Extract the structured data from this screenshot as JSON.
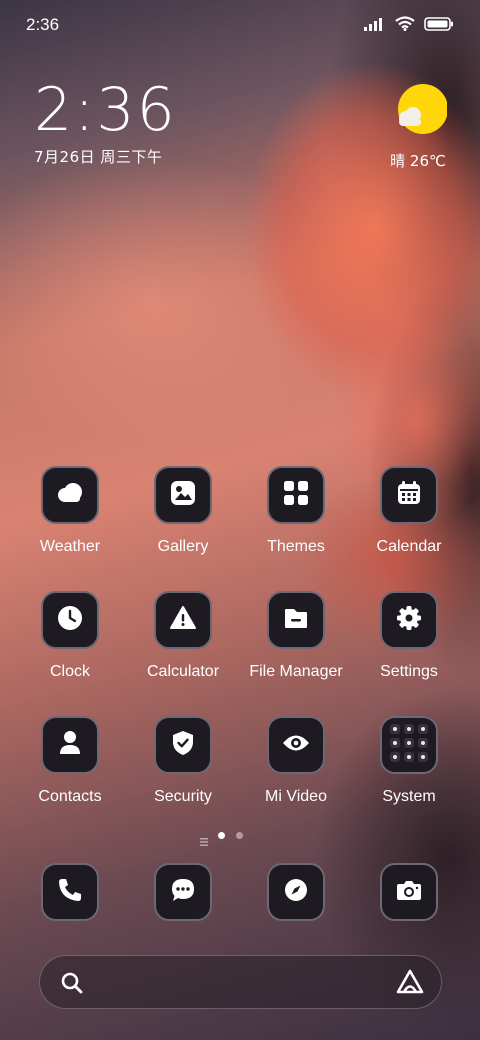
{
  "status_bar": {
    "time": "2:36",
    "icons": [
      "signal-icon",
      "wifi-icon",
      "battery-icon"
    ]
  },
  "clock_widget": {
    "time": "2:36",
    "date": "7月26日 周三下午"
  },
  "weather_widget": {
    "text": "晴 26℃",
    "icon": "sun-cloud-icon",
    "sun_color": "#FFD60A"
  },
  "apps": [
    {
      "label": "Weather",
      "icon": "weather-icon"
    },
    {
      "label": "Gallery",
      "icon": "gallery-icon"
    },
    {
      "label": "Themes",
      "icon": "themes-icon"
    },
    {
      "label": "Calendar",
      "icon": "calendar-icon"
    },
    {
      "label": "Clock",
      "icon": "clock-icon"
    },
    {
      "label": "Calculator",
      "icon": "calculator-icon"
    },
    {
      "label": "File Manager",
      "icon": "file-manager-icon"
    },
    {
      "label": "Settings",
      "icon": "settings-icon"
    },
    {
      "label": "Contacts",
      "icon": "contacts-icon"
    },
    {
      "label": "Security",
      "icon": "security-icon"
    },
    {
      "label": "Mi Video",
      "icon": "mi-video-icon"
    },
    {
      "label": "System",
      "icon": "system-folder-icon"
    }
  ],
  "page_indicator": {
    "pages": 2,
    "current": 1
  },
  "dock": [
    {
      "icon": "phone-icon"
    },
    {
      "icon": "messages-icon"
    },
    {
      "icon": "browser-icon"
    },
    {
      "icon": "camera-icon"
    }
  ],
  "search_bar": {
    "left_icon": "search-icon",
    "right_icon": "assistant-icon"
  },
  "colors": {
    "tile_bg": "#1D1A22",
    "tile_border": "#6D6874",
    "text": "#FFFFFF"
  }
}
